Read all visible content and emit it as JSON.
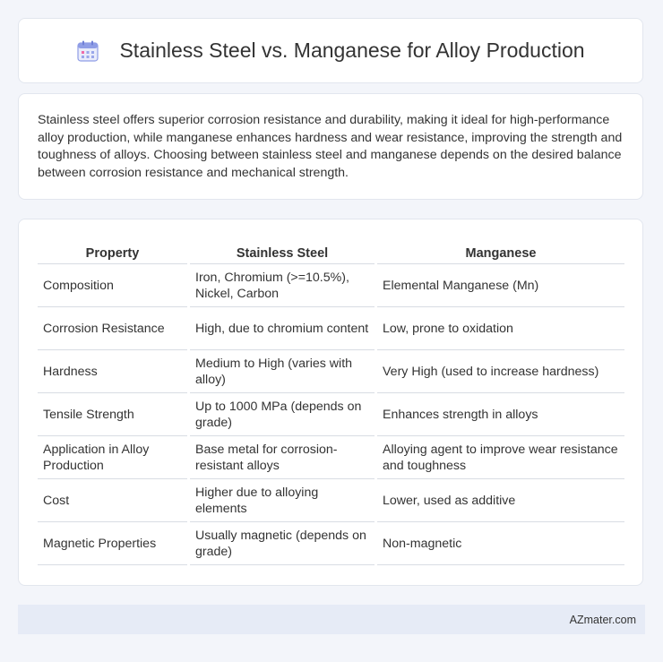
{
  "header": {
    "title": "Stainless Steel vs. Manganese for Alloy Production",
    "icon": "calendar-icon",
    "icon_color": "#7b8de0"
  },
  "description": {
    "text": "Stainless steel offers superior corrosion resistance and durability, making it ideal for high-performance alloy production, while manganese enhances hardness and wear resistance, improving the strength and toughness of alloys. Choosing between stainless steel and manganese depends on the desired balance between corrosion resistance and mechanical strength."
  },
  "table": {
    "headers": [
      "Property",
      "Stainless Steel",
      "Manganese"
    ],
    "rows": [
      [
        "Composition",
        "Iron, Chromium (>=10.5%), Nickel, Carbon",
        "Elemental Manganese (Mn)"
      ],
      [
        "Corrosion Resistance",
        "High, due to chromium content",
        "Low, prone to oxidation"
      ],
      [
        "Hardness",
        "Medium to High (varies with alloy)",
        "Very High (used to increase hardness)"
      ],
      [
        "Tensile Strength",
        "Up to 1000 MPa (depends on grade)",
        "Enhances strength in alloys"
      ],
      [
        "Application in Alloy Production",
        "Base metal for corrosion-resistant alloys",
        "Alloying agent to improve wear resistance and toughness"
      ],
      [
        "Cost",
        "Higher due to alloying elements",
        "Lower, used as additive"
      ],
      [
        "Magnetic Properties",
        "Usually magnetic (depends on grade)",
        "Non-magnetic"
      ]
    ]
  },
  "footer": {
    "brand": "AZmater.com"
  }
}
